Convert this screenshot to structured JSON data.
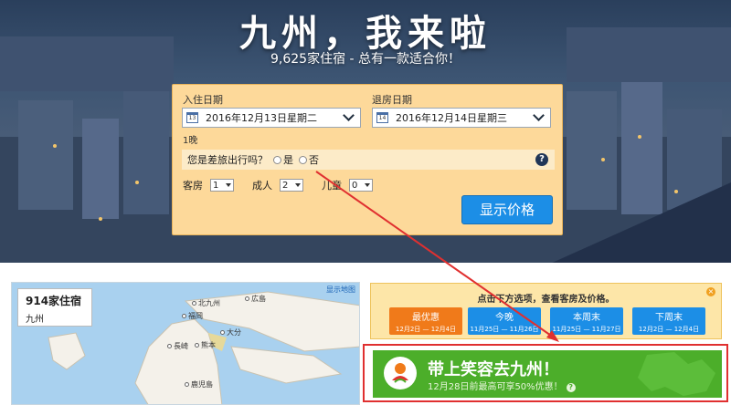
{
  "hero": {
    "title": "九州，我来啦",
    "subtitle": "9,625家住宿 - 总有一款适合你！"
  },
  "search": {
    "checkin_label": "入住日期",
    "checkin_value": "2016年12月13日星期二",
    "checkin_day": "13",
    "checkout_label": "退房日期",
    "checkout_value": "2016年12月14日星期三",
    "checkout_day": "14",
    "nights": "1晚",
    "business_question": "您是差旅出行吗？",
    "yes_label": "是",
    "no_label": "否",
    "help": "?",
    "rooms_label": "客房",
    "rooms_value": "1",
    "adults_label": "成人",
    "adults_value": "2",
    "children_label": "儿童",
    "children_value": "0",
    "submit": "显示价格"
  },
  "map": {
    "count": "914家住宿",
    "region": "九州",
    "show_map": "显示地图",
    "cities": [
      "北九州",
      "広島",
      "福岡",
      "大分",
      "長崎",
      "熊本",
      "鹿児島"
    ]
  },
  "deals": {
    "title": "点击下方选项，查看客房及价格。",
    "close": "×",
    "options": [
      {
        "label": "最优惠",
        "dates": "12月2日 — 12月4日",
        "color": "#f07a1a"
      },
      {
        "label": "今晚",
        "dates": "11月25日 — 11月26日",
        "color": "#1c8ee6"
      },
      {
        "label": "本周末",
        "dates": "11月25日 — 11月27日",
        "color": "#1c8ee6"
      },
      {
        "label": "下周末",
        "dates": "12月2日 — 12月4日",
        "color": "#1c8ee6"
      }
    ]
  },
  "banner": {
    "title": "带上笑容去九州！",
    "subtitle": "12月28日前最高可享50%优惠！",
    "help": "?",
    "color": "#4cae2a"
  },
  "colors": {
    "accent_blue": "#1c8ee6",
    "search_bg": "#fdd99a",
    "highlight_frame": "#e03030"
  }
}
